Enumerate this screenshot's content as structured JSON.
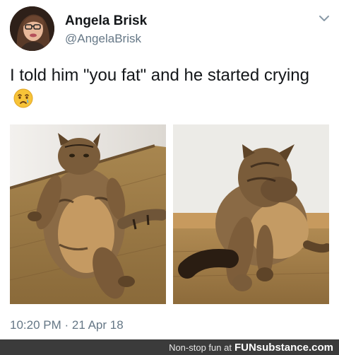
{
  "tweet": {
    "display_name": "Angela Brisk",
    "handle": "@AngelaBrisk",
    "text": "I told him \"you fat\" and he started crying",
    "timestamp": "10:20 PM · 21 Apr 18",
    "avatar_icon": "profile-photo",
    "menu_icon": "chevron-down-icon",
    "emoji_icon": "crying-face-emoji",
    "photos": [
      "sitting-fat-cat-photo",
      "cat-covering-face-photo"
    ]
  },
  "footer": {
    "tagline": "Non-stop fun at",
    "brand": "FUNsubstance.com"
  },
  "colors": {
    "text": "#14171a",
    "secondary": "#657786",
    "footer_bg": "#3b3b3b"
  }
}
